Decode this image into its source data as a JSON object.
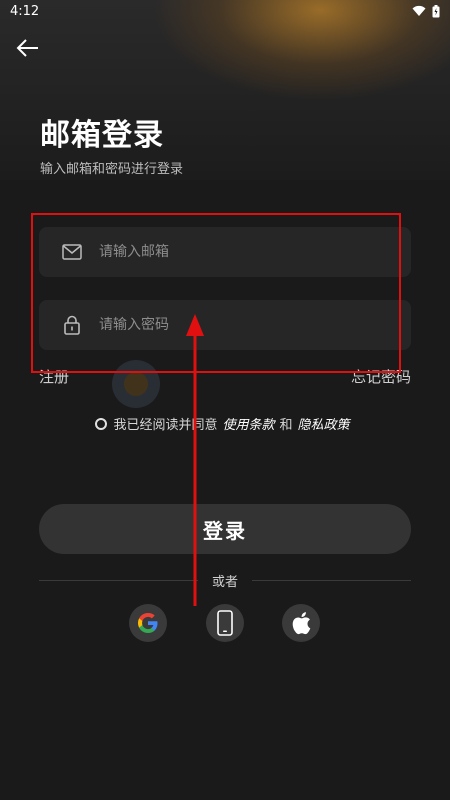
{
  "status_bar": {
    "time": "4:12"
  },
  "header": {
    "title": "邮箱登录",
    "subtitle": "输入邮箱和密码进行登录"
  },
  "form": {
    "email_placeholder": "请输入邮箱",
    "password_placeholder": "请输入密码"
  },
  "links": {
    "register": "注册",
    "forgot_password": "忘记密码"
  },
  "agreement": {
    "prefix": "我已经阅读并同意",
    "terms": "使用条款",
    "conjunction": "和",
    "privacy": "隐私政策"
  },
  "login_button": "登录",
  "divider_text": "或者",
  "social": [
    {
      "icon": "google-icon"
    },
    {
      "icon": "phone-icon"
    },
    {
      "icon": "apple-icon"
    }
  ],
  "colors": {
    "background": "#1a1a1a",
    "field_bg": "#262626",
    "button_bg": "#333333",
    "annotation_red": "#e01010"
  }
}
